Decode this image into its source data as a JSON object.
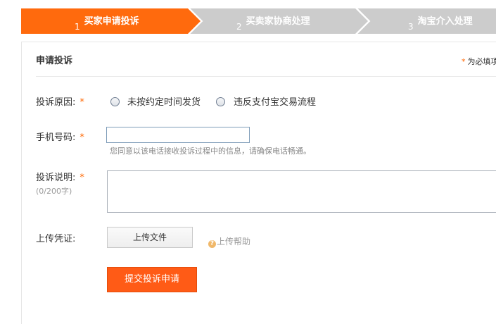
{
  "steps": [
    {
      "num": "1",
      "label": "买家申请投诉"
    },
    {
      "num": "2",
      "label": "买卖家协商处理"
    },
    {
      "num": "3",
      "label": "淘宝介入处理"
    }
  ],
  "panel": {
    "title": "申请投诉",
    "required_star": "*",
    "required_note": "为必填项"
  },
  "form": {
    "reason": {
      "label": "投诉原因:",
      "star": "*",
      "options": [
        "未按约定时间发货",
        "违反支付宝交易流程"
      ]
    },
    "phone": {
      "label": "手机号码:",
      "star": "*",
      "value": "",
      "hint": "您同意以该电话接收投诉过程中的信息，请确保电话畅通。"
    },
    "description": {
      "label": "投诉说明:",
      "star": "*",
      "counter": "(0/200字)",
      "value": ""
    },
    "evidence": {
      "label": "上传凭证:",
      "upload_label": "上传文件",
      "help_label": "上传帮助",
      "help_icon_glyph": "?"
    },
    "submit_label": "提交投诉申请"
  },
  "colors": {
    "accent": "#ff5b16",
    "step_active": "#ff6a0d",
    "step_inactive": "#cccccc"
  }
}
